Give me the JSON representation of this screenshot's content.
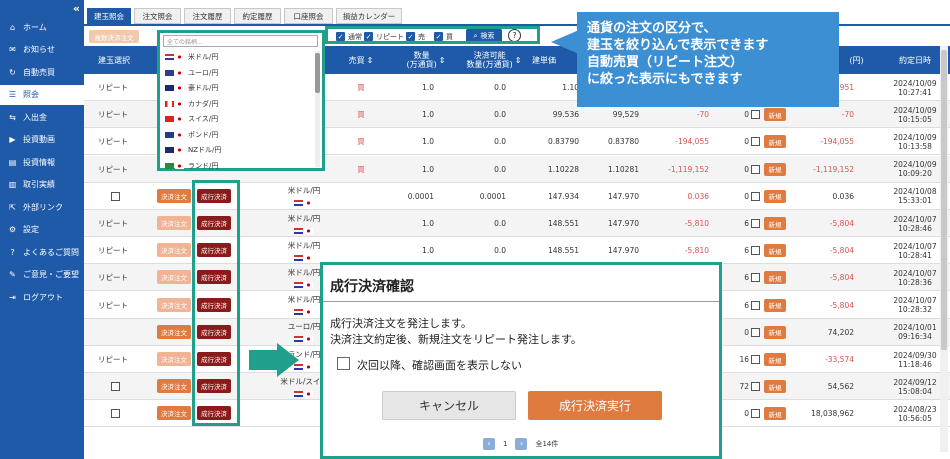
{
  "sidebar": {
    "collapse_icon": "«",
    "items": [
      {
        "label": "ホーム",
        "icon": "home-icon",
        "glyph": "⌂"
      },
      {
        "label": "お知らせ",
        "icon": "mail-icon",
        "glyph": "✉"
      },
      {
        "label": "自動売買",
        "icon": "cycle-icon",
        "glyph": "↻"
      },
      {
        "label": "照会",
        "icon": "list-icon",
        "glyph": "☰"
      },
      {
        "label": "入出金",
        "icon": "transfer-icon",
        "glyph": "⇆"
      },
      {
        "label": "投資動画",
        "icon": "video-icon",
        "glyph": "▶"
      },
      {
        "label": "投資情報",
        "icon": "news-icon",
        "glyph": "▤"
      },
      {
        "label": "取引実績",
        "icon": "chart-icon",
        "glyph": "▥"
      },
      {
        "label": "外部リンク",
        "icon": "external-link-icon",
        "glyph": "⇱"
      },
      {
        "label": "設定",
        "icon": "gear-icon",
        "glyph": "⚙"
      },
      {
        "label": "よくあるご質問",
        "icon": "question-icon",
        "glyph": "?"
      },
      {
        "label": "ご意見・ご要望",
        "icon": "comment-icon",
        "glyph": "✎"
      },
      {
        "label": "ログアウト",
        "icon": "logout-icon",
        "glyph": "⇥"
      }
    ]
  },
  "tabs": [
    "建玉照会",
    "注文照会",
    "注文履歴",
    "約定履歴",
    "口座照会",
    "損益カレンダー"
  ],
  "toolbar": {
    "bulk_button": "複数決済注文",
    "search_placeholder": "全ての銘柄...",
    "filters": [
      "通常",
      "リピート",
      "売",
      "買"
    ],
    "search_button": "検索",
    "help": "?"
  },
  "table": {
    "headers": {
      "type": "建玉選択",
      "side": "売買",
      "qty": "数量\n(万通貨)",
      "settle_qty": "決済可能\n数量(万通貨)",
      "price": "建単価",
      "profit": "(円)",
      "date": "約定日時"
    },
    "rows": [
      {
        "type": "リピート",
        "side": "買",
        "qty": "1.0",
        "settle": "0.0",
        "price": "1.10",
        "p2": "",
        "loss": "",
        "swap": "",
        "loss2": "-102,951",
        "d1": "2024/10/09",
        "d2": "10:27:41"
      },
      {
        "type": "リピート",
        "side": "買",
        "qty": "1.0",
        "settle": "0.0",
        "price": "99.536",
        "p2": "99,529",
        "loss": "-70",
        "swap": "0",
        "loss2": "-70",
        "d1": "2024/10/09",
        "d2": "10:15:05"
      },
      {
        "type": "リピート",
        "side": "買",
        "qty": "1.0",
        "settle": "0.0",
        "price": "0.83790",
        "p2": "0.83780",
        "loss": "-194,055",
        "swap": "0",
        "loss2": "-194,055",
        "d1": "2024/10/09",
        "d2": "10:13:58"
      },
      {
        "type": "リピート",
        "side": "買",
        "qty": "1.0",
        "settle": "0.0",
        "price": "1.10228",
        "p2": "1.10281",
        "loss": "-1,119,152",
        "swap": "0",
        "loss2": "-1,119,152",
        "d1": "2024/10/09",
        "d2": "10:09:20"
      },
      {
        "type": "",
        "side": "",
        "qty": "0.0001",
        "settle": "0.0001",
        "price": "147.934",
        "p2": "147.970",
        "loss": "0.036",
        "swap": "0",
        "loss2": "0.036",
        "d1": "2024/10/08",
        "d2": "15:33:01"
      },
      {
        "type": "リピート",
        "side": "",
        "qty": "1.0",
        "settle": "0.0",
        "price": "148.551",
        "p2": "147.970",
        "loss": "-5,810",
        "swap": "6",
        "loss2": "-5,804",
        "d1": "2024/10/07",
        "d2": "10:28:46"
      },
      {
        "type": "リピート",
        "side": "",
        "qty": "1.0",
        "settle": "0.0",
        "price": "148.551",
        "p2": "147.970",
        "loss": "-5,810",
        "swap": "6",
        "loss2": "-5,804",
        "d1": "2024/10/07",
        "d2": "10:28:41"
      },
      {
        "type": "リピート",
        "side": "",
        "qty": "",
        "settle": "",
        "price": "",
        "p2": "",
        "loss": "",
        "swap": "6",
        "loss2": "-5,804",
        "d1": "2024/10/07",
        "d2": "10:28:36"
      },
      {
        "type": "リピート",
        "side": "",
        "qty": "",
        "settle": "",
        "price": "",
        "p2": "",
        "loss": "",
        "swap": "6",
        "loss2": "-5,804",
        "d1": "2024/10/07",
        "d2": "10:28:32"
      },
      {
        "type": "",
        "side": "",
        "qty": "",
        "settle": "",
        "price": "",
        "p2": "",
        "loss": "-888",
        "swap": "0",
        "loss2": "74,202",
        "d1": "2024/10/01",
        "d2": "09:16:34"
      },
      {
        "type": "リピート",
        "side": "",
        "qty": "",
        "settle": "",
        "price": "",
        "p2": "",
        "loss": "",
        "swap": "16",
        "loss2": "-33,574",
        "d1": "2024/09/30",
        "d2": "11:18:46"
      },
      {
        "type": "",
        "side": "",
        "qty": "",
        "settle": "",
        "price": "",
        "p2": "",
        "loss": "",
        "swap": "72",
        "loss2": "54,562",
        "d1": "2024/09/12",
        "d2": "15:08:04"
      },
      {
        "type": "",
        "side": "",
        "qty": "",
        "settle": "",
        "price": "",
        "p2": "",
        "loss": "",
        "swap": "0",
        "loss2": "18,038,962",
        "d1": "2024/08/23",
        "d2": "10:56:05"
      }
    ],
    "pair_labels": [
      "米ドル/円",
      "米ドル/円",
      "米ドル/円",
      "米ドル/円",
      "米ドル/円",
      "ユーロ/円",
      "ランド/円",
      "米ドル/スイス"
    ],
    "settle_btn": "決済注文",
    "market_btn": "成行決済",
    "new_btn": "新規"
  },
  "dropdown": {
    "placeholder": "全ての銘柄...",
    "items": [
      "米ドル/円",
      "ユーロ/円",
      "豪ドル/円",
      "カナダ/円",
      "スイス/円",
      "ポンド/円",
      "NZドル/円",
      "ランド/円"
    ]
  },
  "callout": {
    "lines": [
      "通貨の注文の区分で、",
      "建玉を絞り込んで表示できます",
      "自動売買（リピート注文）",
      "に絞った表示にもできます"
    ]
  },
  "modal": {
    "title": "成行決済確認",
    "line1": "成行決済注文を発注します。",
    "line2": "決済注文約定後、新規注文をリピート発注します。",
    "checkbox_label": "次回以降、確認画面を表示しない",
    "cancel": "キャンセル",
    "execute": "成行決済実行"
  },
  "pager": {
    "current": "1",
    "total": "全14件",
    "prev": "‹",
    "next": "›"
  }
}
